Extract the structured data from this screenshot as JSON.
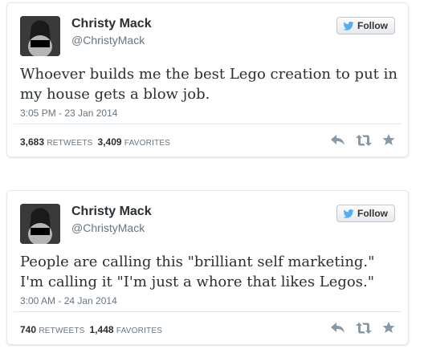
{
  "colors": {
    "twitter_blue": "#55acee",
    "icon_gray": "#8899a6",
    "text": "#292f33",
    "muted": "#66757f"
  },
  "tweets": [
    {
      "name": "Christy Mack",
      "handle": "@ChristyMack",
      "follow_label": "Follow",
      "text": "Whoever builds me the best Lego creation to put in my house gets a blow job.",
      "timestamp": "3:05 PM - 23 Jan 2014",
      "retweets": "3,683",
      "retweets_label": "RETWEETS",
      "favorites": "3,409",
      "favorites_label": "FAVORITES",
      "icons": [
        "reply-icon",
        "retweet-icon",
        "favorite-icon"
      ]
    },
    {
      "name": "Christy Mack",
      "handle": "@ChristyMack",
      "follow_label": "Follow",
      "text": "People are calling this \"brilliant self marketing.\" I'm calling it \"I'm just a whore that likes Legos.\"",
      "timestamp": "3:00 AM - 24 Jan 2014",
      "retweets": "740",
      "retweets_label": "RETWEETS",
      "favorites": "1,448",
      "favorites_label": "FAVORITES",
      "icons": [
        "reply-icon",
        "retweet-icon",
        "favorite-icon"
      ]
    }
  ]
}
